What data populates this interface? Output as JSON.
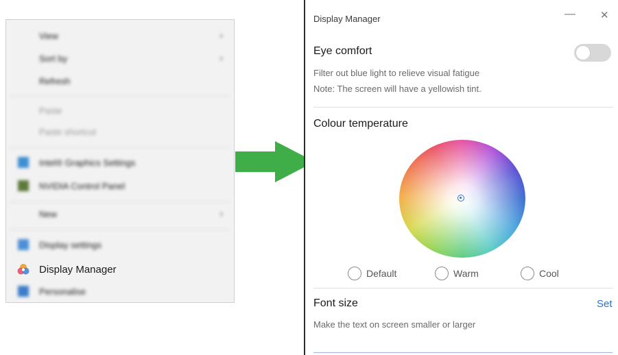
{
  "context_menu": {
    "items": [
      {
        "label": "View",
        "has_submenu": true
      },
      {
        "label": "Sort by",
        "has_submenu": true
      },
      {
        "label": "Refresh",
        "has_submenu": false
      },
      {
        "label": "Paste",
        "has_submenu": false
      },
      {
        "label": "Paste shortcut",
        "has_submenu": false
      },
      {
        "label": "Intel® Graphics Settings",
        "has_submenu": false
      },
      {
        "label": "NVIDIA Control Panel",
        "has_submenu": false
      },
      {
        "label": "New",
        "has_submenu": true
      },
      {
        "label": "Display settings",
        "has_submenu": false
      },
      {
        "label": "Display Manager",
        "has_submenu": false
      },
      {
        "label": "Personalise",
        "has_submenu": false
      }
    ]
  },
  "arrow_color": "#3fae49",
  "display_manager": {
    "title": "Display Manager",
    "minimize_glyph": "—",
    "close_glyph": "✕",
    "eye_comfort": {
      "title": "Eye comfort",
      "desc1": "Filter out blue light to relieve visual fatigue",
      "desc2": "Note: The screen will have a yellowish tint.",
      "enabled": false
    },
    "colour_temperature": {
      "title": "Colour temperature",
      "options": [
        "Default",
        "Warm",
        "Cool"
      ]
    },
    "font_size": {
      "title": "Font size",
      "desc": "Make the text on screen smaller or larger",
      "set_label": "Set"
    }
  },
  "colors": {
    "link": "#2a74c9",
    "toggle_off": "#d8d8d8"
  }
}
